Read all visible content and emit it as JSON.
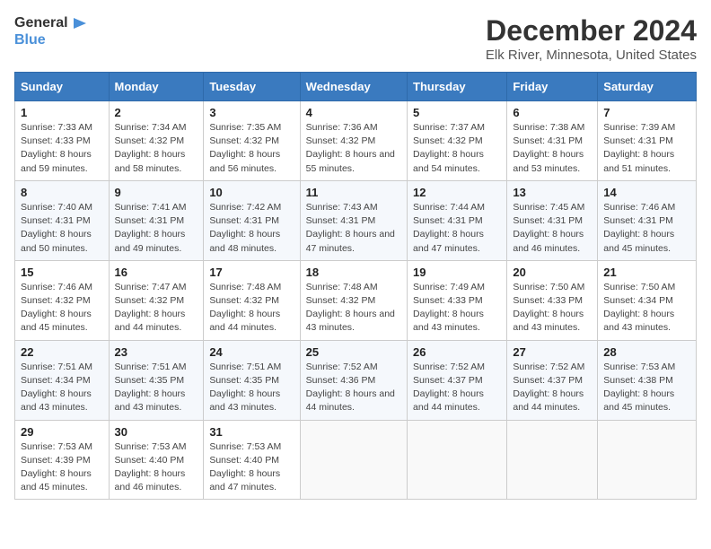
{
  "header": {
    "logo_general": "General",
    "logo_blue": "Blue",
    "title": "December 2024",
    "subtitle": "Elk River, Minnesota, United States"
  },
  "days_of_week": [
    "Sunday",
    "Monday",
    "Tuesday",
    "Wednesday",
    "Thursday",
    "Friday",
    "Saturday"
  ],
  "weeks": [
    [
      {
        "day": "1",
        "sunrise": "7:33 AM",
        "sunset": "4:33 PM",
        "daylight": "8 hours and 59 minutes."
      },
      {
        "day": "2",
        "sunrise": "7:34 AM",
        "sunset": "4:32 PM",
        "daylight": "8 hours and 58 minutes."
      },
      {
        "day": "3",
        "sunrise": "7:35 AM",
        "sunset": "4:32 PM",
        "daylight": "8 hours and 56 minutes."
      },
      {
        "day": "4",
        "sunrise": "7:36 AM",
        "sunset": "4:32 PM",
        "daylight": "8 hours and 55 minutes."
      },
      {
        "day": "5",
        "sunrise": "7:37 AM",
        "sunset": "4:32 PM",
        "daylight": "8 hours and 54 minutes."
      },
      {
        "day": "6",
        "sunrise": "7:38 AM",
        "sunset": "4:31 PM",
        "daylight": "8 hours and 53 minutes."
      },
      {
        "day": "7",
        "sunrise": "7:39 AM",
        "sunset": "4:31 PM",
        "daylight": "8 hours and 51 minutes."
      }
    ],
    [
      {
        "day": "8",
        "sunrise": "7:40 AM",
        "sunset": "4:31 PM",
        "daylight": "8 hours and 50 minutes."
      },
      {
        "day": "9",
        "sunrise": "7:41 AM",
        "sunset": "4:31 PM",
        "daylight": "8 hours and 49 minutes."
      },
      {
        "day": "10",
        "sunrise": "7:42 AM",
        "sunset": "4:31 PM",
        "daylight": "8 hours and 48 minutes."
      },
      {
        "day": "11",
        "sunrise": "7:43 AM",
        "sunset": "4:31 PM",
        "daylight": "8 hours and 47 minutes."
      },
      {
        "day": "12",
        "sunrise": "7:44 AM",
        "sunset": "4:31 PM",
        "daylight": "8 hours and 47 minutes."
      },
      {
        "day": "13",
        "sunrise": "7:45 AM",
        "sunset": "4:31 PM",
        "daylight": "8 hours and 46 minutes."
      },
      {
        "day": "14",
        "sunrise": "7:46 AM",
        "sunset": "4:31 PM",
        "daylight": "8 hours and 45 minutes."
      }
    ],
    [
      {
        "day": "15",
        "sunrise": "7:46 AM",
        "sunset": "4:32 PM",
        "daylight": "8 hours and 45 minutes."
      },
      {
        "day": "16",
        "sunrise": "7:47 AM",
        "sunset": "4:32 PM",
        "daylight": "8 hours and 44 minutes."
      },
      {
        "day": "17",
        "sunrise": "7:48 AM",
        "sunset": "4:32 PM",
        "daylight": "8 hours and 44 minutes."
      },
      {
        "day": "18",
        "sunrise": "7:48 AM",
        "sunset": "4:32 PM",
        "daylight": "8 hours and 43 minutes."
      },
      {
        "day": "19",
        "sunrise": "7:49 AM",
        "sunset": "4:33 PM",
        "daylight": "8 hours and 43 minutes."
      },
      {
        "day": "20",
        "sunrise": "7:50 AM",
        "sunset": "4:33 PM",
        "daylight": "8 hours and 43 minutes."
      },
      {
        "day": "21",
        "sunrise": "7:50 AM",
        "sunset": "4:34 PM",
        "daylight": "8 hours and 43 minutes."
      }
    ],
    [
      {
        "day": "22",
        "sunrise": "7:51 AM",
        "sunset": "4:34 PM",
        "daylight": "8 hours and 43 minutes."
      },
      {
        "day": "23",
        "sunrise": "7:51 AM",
        "sunset": "4:35 PM",
        "daylight": "8 hours and 43 minutes."
      },
      {
        "day": "24",
        "sunrise": "7:51 AM",
        "sunset": "4:35 PM",
        "daylight": "8 hours and 43 minutes."
      },
      {
        "day": "25",
        "sunrise": "7:52 AM",
        "sunset": "4:36 PM",
        "daylight": "8 hours and 44 minutes."
      },
      {
        "day": "26",
        "sunrise": "7:52 AM",
        "sunset": "4:37 PM",
        "daylight": "8 hours and 44 minutes."
      },
      {
        "day": "27",
        "sunrise": "7:52 AM",
        "sunset": "4:37 PM",
        "daylight": "8 hours and 44 minutes."
      },
      {
        "day": "28",
        "sunrise": "7:53 AM",
        "sunset": "4:38 PM",
        "daylight": "8 hours and 45 minutes."
      }
    ],
    [
      {
        "day": "29",
        "sunrise": "7:53 AM",
        "sunset": "4:39 PM",
        "daylight": "8 hours and 45 minutes."
      },
      {
        "day": "30",
        "sunrise": "7:53 AM",
        "sunset": "4:40 PM",
        "daylight": "8 hours and 46 minutes."
      },
      {
        "day": "31",
        "sunrise": "7:53 AM",
        "sunset": "4:40 PM",
        "daylight": "8 hours and 47 minutes."
      },
      null,
      null,
      null,
      null
    ]
  ],
  "labels": {
    "sunrise": "Sunrise:",
    "sunset": "Sunset:",
    "daylight": "Daylight:"
  }
}
